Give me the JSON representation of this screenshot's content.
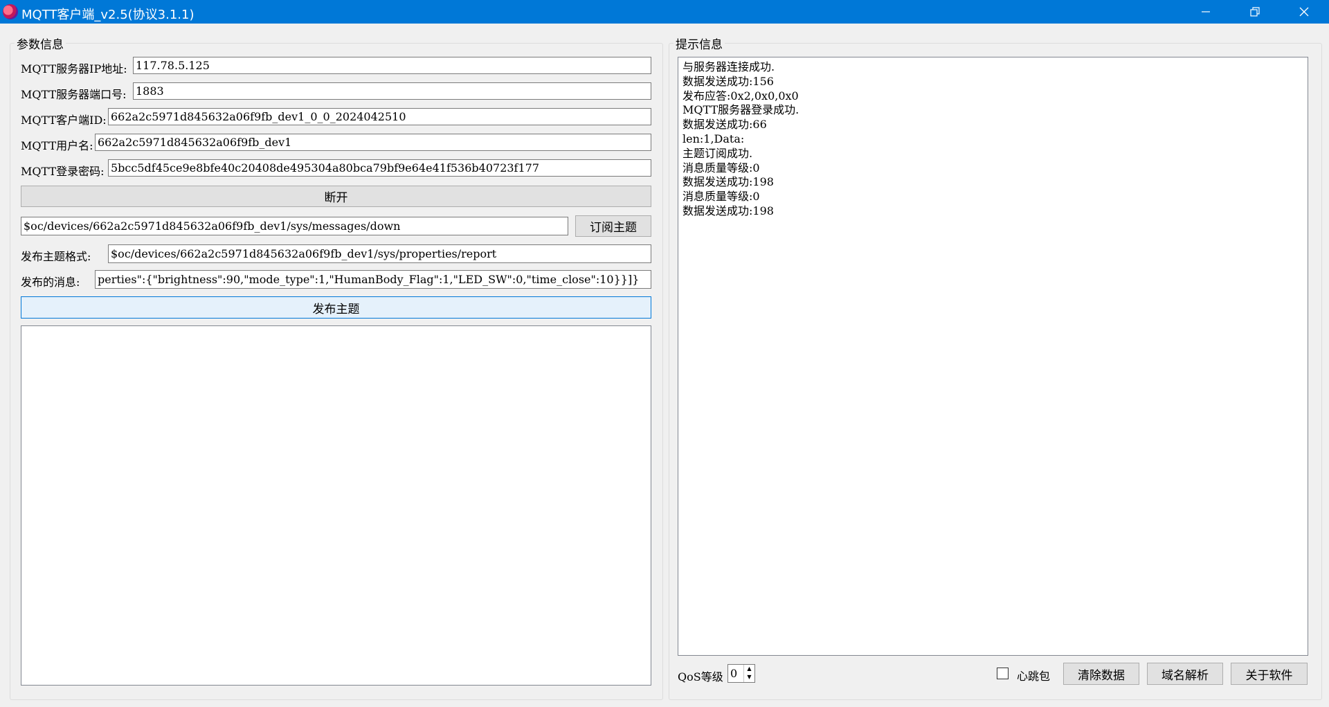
{
  "window": {
    "title": "MQTT客户端_v2.5(协议3.1.1)"
  },
  "params": {
    "group_title": "参数信息",
    "ip_label": "MQTT服务器IP地址:",
    "ip_value": "117.78.5.125",
    "port_label": "MQTT服务器端口号:",
    "port_value": "1883",
    "client_id_label": "MQTT客户端ID:",
    "client_id_value": "662a2c5971d845632a06f9fb_dev1_0_0_2024042510",
    "username_label": "MQTT用户名:",
    "username_value": "662a2c5971d845632a06f9fb_dev1",
    "password_label": "MQTT登录密码:",
    "password_value": "5bcc5df45ce9e8bfe40c20408de495304a80bca79bf9e64e41f536b40723f177",
    "disconnect_button": "断开",
    "subscribe_topic_value": "$oc/devices/662a2c5971d845632a06f9fb_dev1/sys/messages/down",
    "subscribe_button": "订阅主题",
    "publish_topic_label": "发布主题格式:",
    "publish_topic_value": "$oc/devices/662a2c5971d845632a06f9fb_dev1/sys/properties/report",
    "publish_message_label": "发布的消息:",
    "publish_message_value": "perties\":{\"brightness\":90,\"mode_type\":1,\"HumanBody_Flag\":1,\"LED_SW\":0,\"time_close\":10}}]}",
    "publish_button": "发布主题"
  },
  "info": {
    "group_title": "提示信息",
    "log_lines": [
      "与服务器连接成功.",
      "数据发送成功:156",
      "发布应答:0x2,0x0,0x0",
      "MQTT服务器登录成功.",
      "数据发送成功:66",
      "len:1,Data:",
      "主题订阅成功.",
      "消息质量等级:0",
      "数据发送成功:198",
      "消息质量等级:0",
      "数据发送成功:198"
    ]
  },
  "footer": {
    "qos_label": "QoS等级",
    "qos_value": "0",
    "heartbeat_label": "心跳包",
    "heartbeat_checked": false,
    "clear_button": "清除数据",
    "dns_button": "域名解析",
    "about_button": "关于软件"
  },
  "colors": {
    "titlebar": "#0078d7",
    "background": "#f0f0f0",
    "focus_border": "#0078d7"
  }
}
